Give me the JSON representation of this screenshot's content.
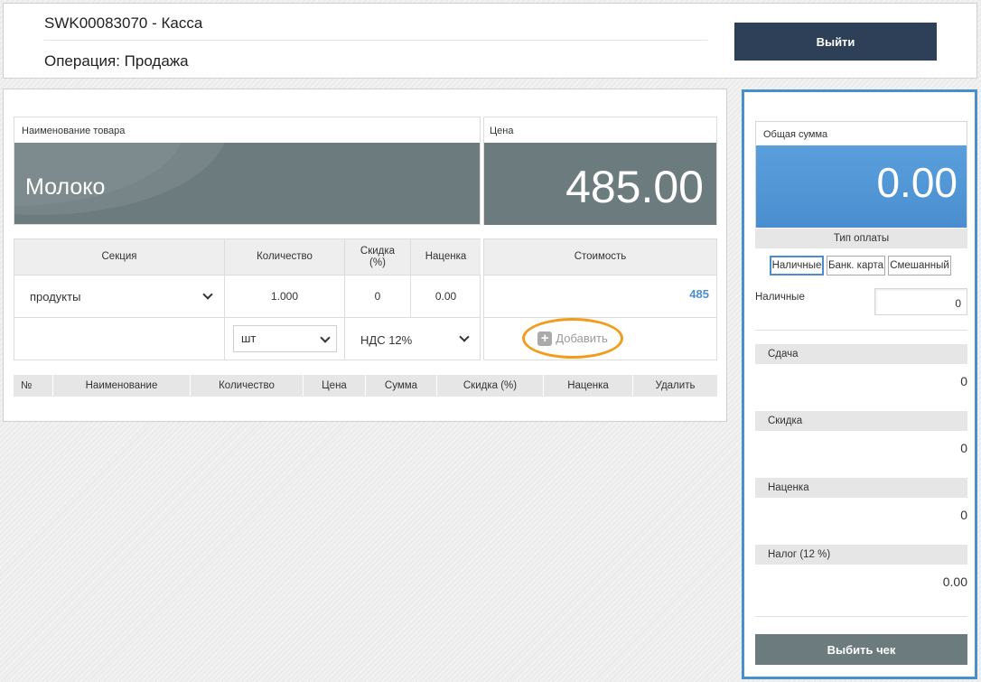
{
  "header": {
    "title": "SWK00083070 - Касса",
    "operation": "Операция: Продажа",
    "logout_label": "Выйти"
  },
  "product": {
    "name_caption": "Наименование товара",
    "name_value": "Молоко",
    "price_caption": "Цена",
    "price_value": "485.00"
  },
  "entry": {
    "headers": {
      "section": "Секция",
      "quantity": "Количество",
      "discount": "Скидка (%)",
      "markup": "Наценка",
      "cost": "Стоимость"
    },
    "section_value": "продукты",
    "quantity_value": "1.000",
    "discount_value": "0",
    "markup_value": "0.00",
    "cost_value": "485",
    "unit_value": "шт",
    "vat_value": "НДС 12%",
    "add_label": "Добавить"
  },
  "list_headers": [
    "№",
    "Наименование",
    "Количество",
    "Цена",
    "Сумма",
    "Скидка (%)",
    "Наценка",
    "Удалить"
  ],
  "side": {
    "total_caption": "Общая сумма",
    "total_value": "0.00",
    "paytype_caption": "Тип оплаты",
    "pay_options": [
      "Наличные",
      "Банк. карта",
      "Смешанный"
    ],
    "cash_label": "Наличные",
    "cash_value": "0",
    "change_caption": "Сдача",
    "change_value": "0",
    "discount_caption": "Скидка",
    "discount_value": "0",
    "markup_caption": "Наценка",
    "markup_value": "0",
    "tax_caption": "Налог (12 %)",
    "tax_value": "0.00",
    "print_label": "Выбить чек"
  },
  "colors": {
    "header_button": "#2e4057",
    "display_gray": "#6c7b7e",
    "total_blue": "#4a8ecf",
    "side_border": "#4a90c8",
    "add_ring": "#f19c1c"
  }
}
